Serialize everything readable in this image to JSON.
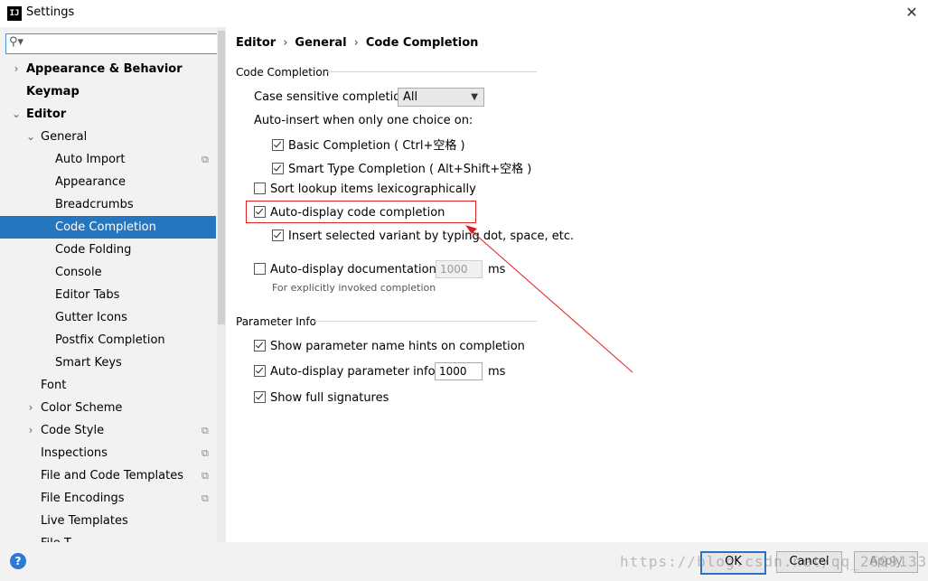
{
  "window": {
    "title": "Settings",
    "app_icon_text": "IJ",
    "close_glyph": "✕"
  },
  "search": {
    "value": "",
    "icon": "search-icon"
  },
  "tree": [
    {
      "label": "Appearance & Behavior",
      "level": 0,
      "bold": true,
      "arrow": "›",
      "copy": false,
      "selected": false
    },
    {
      "label": "Keymap",
      "level": 0,
      "bold": true,
      "arrow": "",
      "copy": false,
      "selected": false
    },
    {
      "label": "Editor",
      "level": 0,
      "bold": true,
      "arrow": "⌄",
      "copy": false,
      "selected": false
    },
    {
      "label": "General",
      "level": 1,
      "bold": false,
      "arrow": "⌄",
      "copy": false,
      "selected": false
    },
    {
      "label": "Auto Import",
      "level": 2,
      "bold": false,
      "arrow": "",
      "copy": true,
      "selected": false
    },
    {
      "label": "Appearance",
      "level": 2,
      "bold": false,
      "arrow": "",
      "copy": false,
      "selected": false
    },
    {
      "label": "Breadcrumbs",
      "level": 2,
      "bold": false,
      "arrow": "",
      "copy": false,
      "selected": false
    },
    {
      "label": "Code Completion",
      "level": 2,
      "bold": false,
      "arrow": "",
      "copy": false,
      "selected": true
    },
    {
      "label": "Code Folding",
      "level": 2,
      "bold": false,
      "arrow": "",
      "copy": false,
      "selected": false
    },
    {
      "label": "Console",
      "level": 2,
      "bold": false,
      "arrow": "",
      "copy": false,
      "selected": false
    },
    {
      "label": "Editor Tabs",
      "level": 2,
      "bold": false,
      "arrow": "",
      "copy": false,
      "selected": false
    },
    {
      "label": "Gutter Icons",
      "level": 2,
      "bold": false,
      "arrow": "",
      "copy": false,
      "selected": false
    },
    {
      "label": "Postfix Completion",
      "level": 2,
      "bold": false,
      "arrow": "",
      "copy": false,
      "selected": false
    },
    {
      "label": "Smart Keys",
      "level": 2,
      "bold": false,
      "arrow": "",
      "copy": false,
      "selected": false
    },
    {
      "label": "Font",
      "level": 1,
      "bold": false,
      "arrow": "",
      "copy": false,
      "selected": false
    },
    {
      "label": "Color Scheme",
      "level": 1,
      "bold": false,
      "arrow": "›",
      "copy": false,
      "selected": false
    },
    {
      "label": "Code Style",
      "level": 1,
      "bold": false,
      "arrow": "›",
      "copy": true,
      "selected": false
    },
    {
      "label": "Inspections",
      "level": 1,
      "bold": false,
      "arrow": "",
      "copy": true,
      "selected": false
    },
    {
      "label": "File and Code Templates",
      "level": 1,
      "bold": false,
      "arrow": "",
      "copy": true,
      "selected": false
    },
    {
      "label": "File Encodings",
      "level": 1,
      "bold": false,
      "arrow": "",
      "copy": true,
      "selected": false
    },
    {
      "label": "Live Templates",
      "level": 1,
      "bold": false,
      "arrow": "",
      "copy": false,
      "selected": false
    },
    {
      "label": "File T...",
      "level": 1,
      "bold": false,
      "arrow": "",
      "copy": false,
      "selected": false
    }
  ],
  "breadcrumb": [
    "Editor",
    "General",
    "Code Completion"
  ],
  "breadcrumb_sep": "›",
  "code_completion": {
    "section_title": "Code Completion",
    "case_sensitive_label": "Case sensitive completion:",
    "case_sensitive_value": "All",
    "auto_insert_label": "Auto-insert when only one choice on:",
    "basic_completion": {
      "label": "Basic Completion ( Ctrl+空格 )",
      "checked": true
    },
    "smart_type_completion": {
      "label": "Smart Type Completion ( Alt+Shift+空格 )",
      "checked": true
    },
    "sort_lexicographically": {
      "label": "Sort lookup items lexicographically",
      "checked": false
    },
    "auto_display": {
      "label": "Auto-display code completion",
      "checked": true
    },
    "insert_selected_variant": {
      "label": "Insert selected variant by typing dot, space, etc.",
      "checked": true
    },
    "auto_display_docs": {
      "label": "Auto-display documentation in",
      "checked": false,
      "value": "1000",
      "unit": "ms"
    },
    "docs_hint": "For explicitly invoked completion"
  },
  "parameter_info": {
    "section_title": "Parameter Info",
    "show_hints": {
      "label": "Show parameter name hints on completion",
      "checked": true
    },
    "auto_display_info": {
      "label": "Auto-display parameter info in",
      "checked": true,
      "value": "1000",
      "unit": "ms"
    },
    "show_signatures": {
      "label": "Show full signatures",
      "checked": true
    }
  },
  "buttons": {
    "help": "?",
    "ok": "OK",
    "cancel": "Cancel",
    "apply": "Apply"
  },
  "watermark": "https://blog.csdn.net/qq_26991333",
  "colors": {
    "selection": "#2675bf",
    "annotation": "#e02020",
    "primary_button_border": "#2b72c4"
  }
}
